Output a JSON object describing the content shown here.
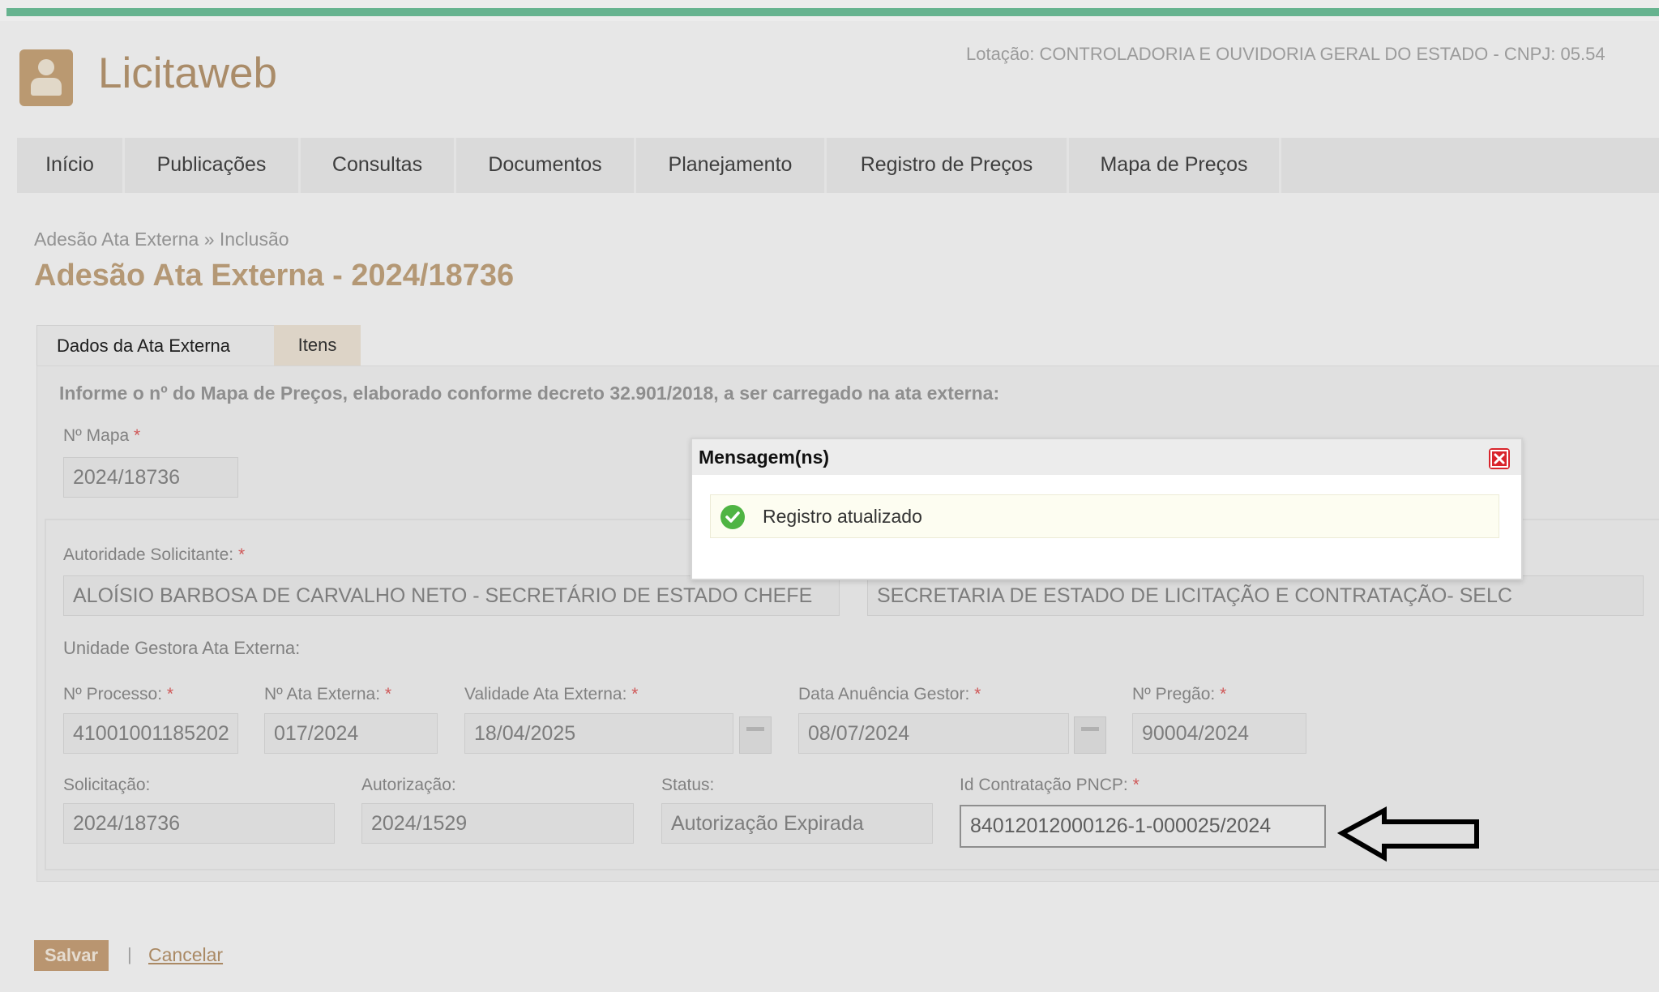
{
  "app": {
    "brand": "Licitaweb",
    "lotacao": "Lotação: CONTROLADORIA E OUVIDORIA GERAL DO ESTADO - CNPJ: 05.54"
  },
  "nav": {
    "items": [
      "Início",
      "Publicações",
      "Consultas",
      "Documentos",
      "Planejamento",
      "Registro de Preços",
      "Mapa de Preços"
    ]
  },
  "breadcrumb": "Adesão Ata Externa » Inclusão",
  "page_title": "Adesão Ata Externa - 2024/18736",
  "tabs": [
    "Dados da Ata Externa",
    "Itens"
  ],
  "form": {
    "info_text": "Informe o nº do Mapa de Preços, elaborado conforme decreto 32.901/2018, a ser carregado na ata externa:",
    "mapa": {
      "label": "Nº Mapa",
      "value": "2024/18736"
    },
    "autoridade": {
      "label": "Autoridade Solicitante:",
      "value": "ALOÍSIO BARBOSA DE CARVALHO NETO - SECRETÁRIO DE ESTADO CHEFE",
      "orgao_value": "SECRETARIA DE ESTADO DE LICITAÇÃO E CONTRATAÇÃO- SELC"
    },
    "unidade_label": "Unidade Gestora Ata Externa:",
    "processo": {
      "label": "Nº Processo:",
      "value": "41001001185202"
    },
    "ata_externa": {
      "label": "Nº Ata Externa:",
      "value": "017/2024"
    },
    "validade": {
      "label": "Validade Ata Externa:",
      "value": "18/04/2025"
    },
    "anuencia": {
      "label": "Data Anuência Gestor:",
      "value": "08/07/2024"
    },
    "pregao": {
      "label": "Nº Pregão:",
      "value": "90004/2024"
    },
    "solicitacao": {
      "label": "Solicitação:",
      "value": "2024/18736"
    },
    "autorizacao": {
      "label": "Autorização:",
      "value": "2024/1529"
    },
    "status": {
      "label": "Status:",
      "value": "Autorização Expirada"
    },
    "pncp": {
      "label": "Id Contratação PNCP:",
      "value": "84012012000126-1-000025/2024"
    },
    "required_mark": "*"
  },
  "dialog": {
    "title": "Mensagem(ns)",
    "message": "Registro atualizado"
  },
  "actions": {
    "save_label": "Salvar",
    "separator": "|",
    "cancel_label": "Cancelar"
  },
  "colors": {
    "accent": "#6fc29b",
    "brand": "#b89872",
    "button": "#c8a27a",
    "close": "#d9252c",
    "success": "#4fb443"
  },
  "icons": [
    "user-logo-icon",
    "close-icon",
    "check-circle-icon",
    "calendar-button-icon",
    "left-arrow-annotation-icon"
  ]
}
